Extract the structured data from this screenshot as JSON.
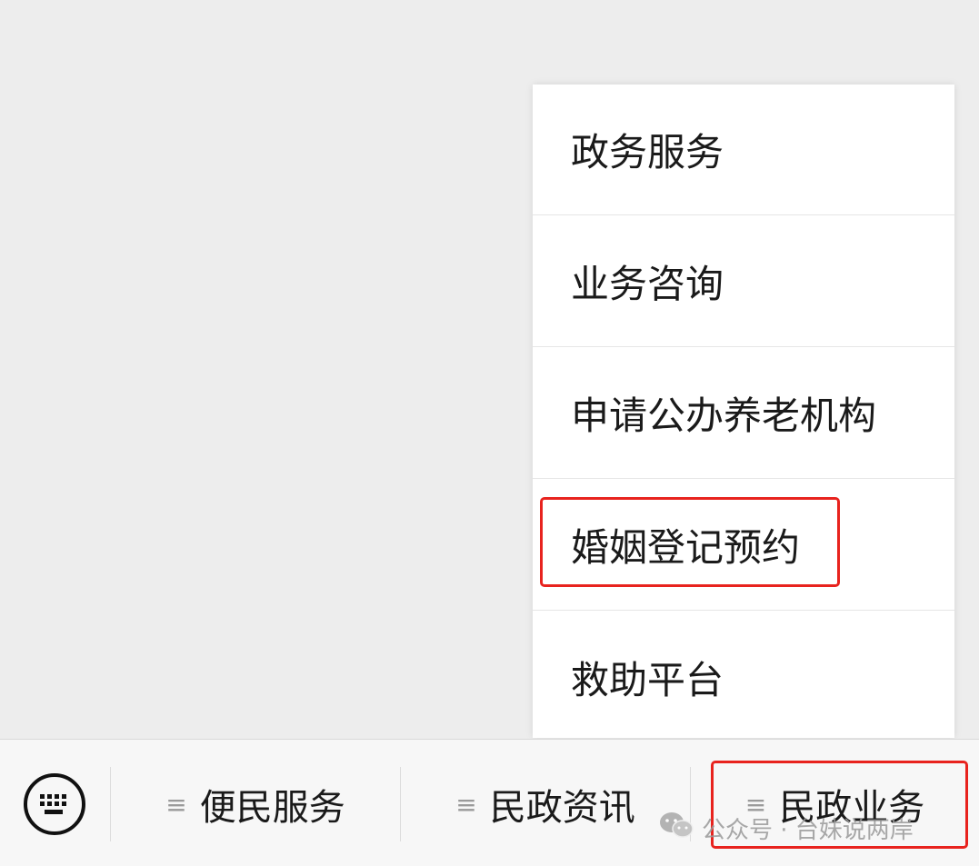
{
  "popup_menu": {
    "items": [
      {
        "label": "政务服务"
      },
      {
        "label": "业务咨询"
      },
      {
        "label": "申请公办养老机构"
      },
      {
        "label": "婚姻登记预约"
      },
      {
        "label": "救助平台"
      }
    ],
    "highlighted_item": "婚姻登记预约"
  },
  "bottom_bar": {
    "keyboard_icon": "keyboard-icon",
    "tabs": [
      {
        "label": "便民服务",
        "icon": "menu-lines-icon"
      },
      {
        "label": "民政资讯",
        "icon": "menu-lines-icon"
      },
      {
        "label": "民政业务",
        "icon": "menu-lines-icon",
        "highlighted": true
      }
    ]
  },
  "watermark": {
    "text": "公众号 · 台妹说两岸",
    "icon": "wechat-icon"
  },
  "colors": {
    "highlight": "#e8231e",
    "background": "#ededed",
    "menu_background": "#ffffff",
    "bar_background": "#f7f7f7"
  }
}
